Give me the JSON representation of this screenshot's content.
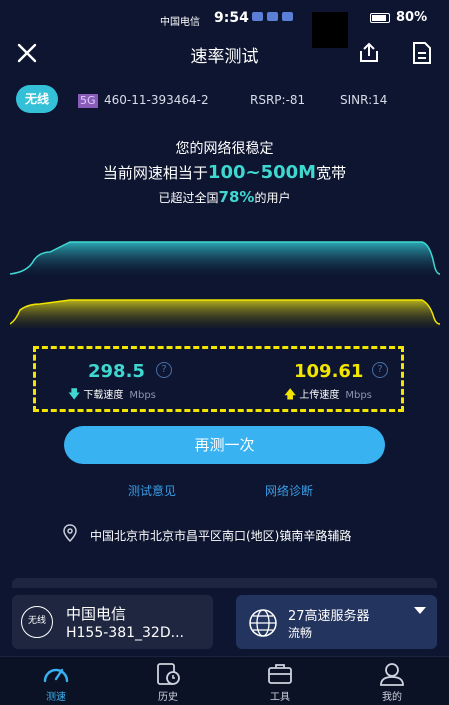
{
  "status_bar": {
    "carrier": "中国电信",
    "time": "9:54",
    "battery": "80%"
  },
  "header": {
    "title": "速率测试"
  },
  "network": {
    "type_badge": "无线",
    "gen": "5G",
    "plmn": "460-11-393464-2",
    "rsrp": "RSRP:-81",
    "sinr": "SINR:14"
  },
  "summary": {
    "line1": "您的网络很稳定",
    "line2_prefix": "当前网速相当于",
    "line2_highlight": "100~500M",
    "line2_suffix": "宽带",
    "line3_prefix": "已超过全国",
    "line3_highlight": "78%",
    "line3_suffix": "的用户"
  },
  "results": {
    "download_value": "298.5",
    "download_label": "下载速度",
    "download_unit": "Mbps",
    "upload_value": "109.61",
    "upload_label": "上传速度",
    "upload_unit": "Mbps",
    "help_glyph": "?"
  },
  "actions": {
    "retest_label": "再测一次",
    "feedback_label": "测试意见",
    "diagnose_label": "网络诊断"
  },
  "location": {
    "address": "中国北京市北京市昌平区南口(地区)镇南辛路辅路"
  },
  "carrier_card": {
    "logo_text": "无线",
    "name": "中国电信",
    "model": "H155-381_32D..."
  },
  "server_card": {
    "name": "27高速服务器",
    "status": "流畅"
  },
  "tabbar": {
    "tabs": [
      {
        "label": "测速",
        "icon": "speedometer-icon",
        "active": true
      },
      {
        "label": "历史",
        "icon": "history-icon",
        "active": false
      },
      {
        "label": "工具",
        "icon": "toolbox-icon",
        "active": false
      },
      {
        "label": "我的",
        "icon": "profile-icon",
        "active": false
      }
    ]
  },
  "colors": {
    "background": "#0d1530",
    "download_accent": "#3fd8d0",
    "upload_accent": "#f2e500",
    "primary_button": "#38b2f0",
    "link": "#3a9de6"
  }
}
